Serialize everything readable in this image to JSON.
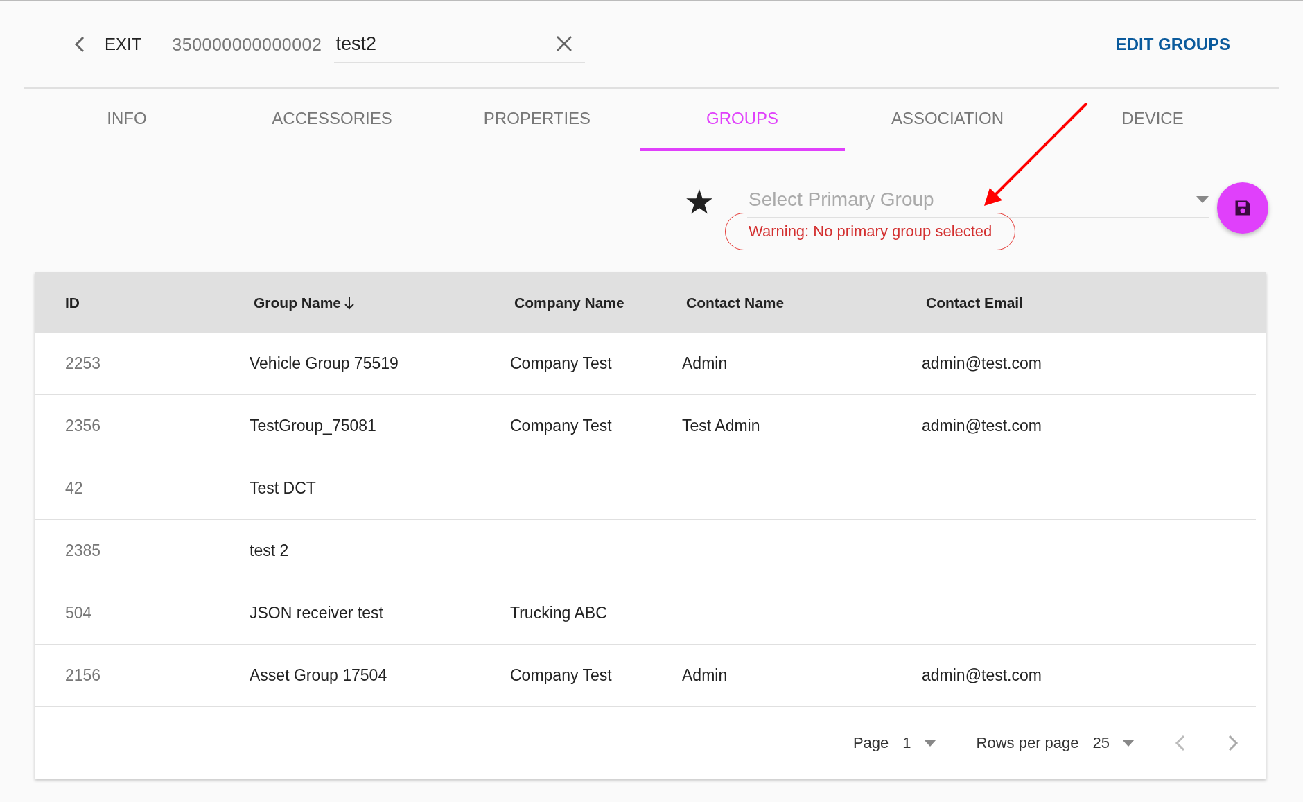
{
  "header": {
    "exit_label": "EXIT",
    "device_id": "350000000000002",
    "name_value": "test2",
    "edit_groups": "EDIT GROUPS"
  },
  "tabs": [
    {
      "label": "INFO",
      "selected": false
    },
    {
      "label": "ACCESSORIES",
      "selected": false
    },
    {
      "label": "PROPERTIES",
      "selected": false
    },
    {
      "label": "GROUPS",
      "selected": true
    },
    {
      "label": "ASSOCIATION",
      "selected": false
    },
    {
      "label": "DEVICE",
      "selected": false
    }
  ],
  "primary_group": {
    "placeholder": "Select Primary Group",
    "warning": "Warning: No primary group selected"
  },
  "table": {
    "columns": [
      {
        "label": "ID",
        "sorted": false
      },
      {
        "label": "Group Name",
        "sorted": true
      },
      {
        "label": "Company Name",
        "sorted": false
      },
      {
        "label": "Contact Name",
        "sorted": false
      },
      {
        "label": "Contact Email",
        "sorted": false
      }
    ],
    "rows": [
      [
        "2253",
        "Vehicle Group 75519",
        "Company Test",
        "Admin",
        "admin@test.com"
      ],
      [
        "2356",
        "TestGroup_75081",
        "Company Test",
        "Test Admin",
        "admin@test.com"
      ],
      [
        "42",
        "Test DCT",
        "",
        "",
        ""
      ],
      [
        "2385",
        "test 2",
        "",
        "",
        ""
      ],
      [
        "504",
        "JSON receiver test",
        "Trucking ABC",
        "",
        ""
      ],
      [
        "2156",
        "Asset Group 17504",
        "Company Test",
        "Admin",
        "admin@test.com"
      ]
    ]
  },
  "pagination": {
    "page_label": "Page",
    "page_value": "1",
    "rows_label": "Rows per page",
    "rows_value": "25"
  }
}
